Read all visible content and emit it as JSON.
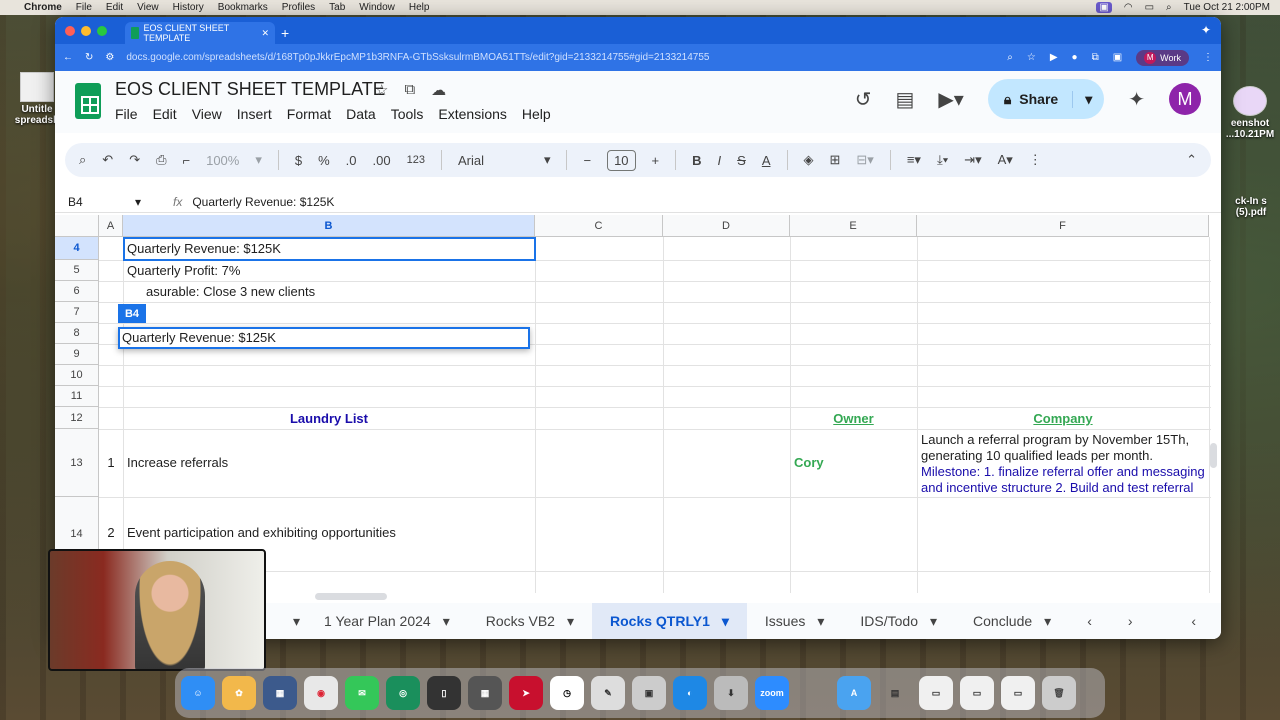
{
  "mac_menubar": {
    "app": "Chrome",
    "items": [
      "File",
      "Edit",
      "View",
      "History",
      "Bookmarks",
      "Profiles",
      "Tab",
      "Window",
      "Help"
    ],
    "datetime": "Tue Oct 21  2:00PM"
  },
  "desktop": {
    "left_icon_label": "Untitle spreadsh",
    "right_icon_label_1": "eenshot ...10.21PM",
    "right_icon_label_2": "ck-In s (5).pdf"
  },
  "browser": {
    "tab_title": "EOS CLIENT SHEET TEMPLATE",
    "url_host": "docs.google.com",
    "url_path": "/spreadsheets/d/168Tp0pJkkrEpcMP1b3RNFA-GTbSsksulrmBMOA51TTs/edit?gid=2133214755#gid=2133214755",
    "profile_initial": "M",
    "profile_label": "Work"
  },
  "doc": {
    "title": "EOS CLIENT SHEET TEMPLATE",
    "menu": [
      "File",
      "Edit",
      "View",
      "Insert",
      "Format",
      "Data",
      "Tools",
      "Extensions",
      "Help"
    ],
    "share_label": "Share",
    "avatar_initial": "M"
  },
  "toolbar": {
    "zoom": "100%",
    "currency": "$",
    "percent": "%",
    "dec_decrease": ".0",
    "dec_increase": ".00",
    "number_format": "123",
    "font": "Arial",
    "font_size": "10"
  },
  "formula": {
    "cell_ref": "B4",
    "fx": "fx",
    "content": "Quarterly Revenue: $125K"
  },
  "grid": {
    "columns": [
      "A",
      "B",
      "C",
      "D",
      "E",
      "F"
    ],
    "rows": [
      "4",
      "5",
      "6",
      "7",
      "8",
      "9",
      "10",
      "11",
      "12",
      "13",
      "14"
    ],
    "cells": {
      "b4": "Quarterly Revenue: $125K",
      "b5": "Quarterly Profit: 7%",
      "b6": "asurable: Close 3 new clients",
      "b12": "Laundry List",
      "e12": "Owner",
      "f12": "Company",
      "a13": "1",
      "b13": "Increase referrals",
      "e13": "Cory",
      "f13_line1": " Launch a referral program by November 15Th,",
      "f13_line2": "generating 10 qualified leads per month.",
      "f13_line3": "Milestone: 1. finalize referral offer and messaging",
      "f13_line4": "and incentive structure 2. Build and test  referral",
      "a14": "2",
      "b14": "Event participation and exhibiting opportunities"
    },
    "editor_value": "Quarterly Revenue: $125K",
    "cell_tag": "B4"
  },
  "sheet_tabs": [
    {
      "label": "1 Year Plan 2024",
      "active": false
    },
    {
      "label": "Rocks VB2",
      "active": false
    },
    {
      "label": "Rocks QTRLY1",
      "active": true
    },
    {
      "label": "Issues",
      "active": false
    },
    {
      "label": "IDS/Todo",
      "active": false
    },
    {
      "label": "Conclude",
      "active": false
    }
  ],
  "dock": {
    "zoom_label": "zoom"
  },
  "colors": {
    "accent": "#1a73e8",
    "sheets_green": "#0f9d58",
    "chrome_blue": "#2f73e6",
    "laundry_blue": "#1a0dab",
    "owner_green": "#34a853"
  }
}
